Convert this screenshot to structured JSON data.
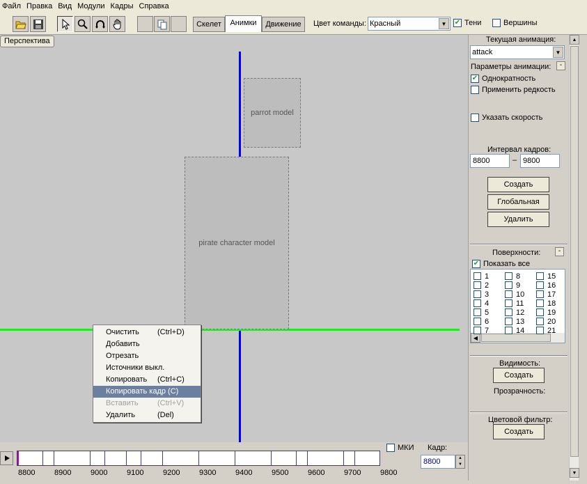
{
  "menu": [
    "Файл",
    "Правка",
    "Вид",
    "Модули",
    "Кадры",
    "Справка"
  ],
  "toolbar": {
    "icons": [
      "open-folder-icon",
      "save-icon",
      "pointer-icon",
      "zoom-icon",
      "rotate-icon",
      "hand-icon",
      "blank-icon",
      "copy-icon"
    ],
    "tabs": [
      "Скелет",
      "Анимки",
      "Движение"
    ],
    "active_tab": "Анимки",
    "team_color_label": "Цвет команды:",
    "team_color_value": "Красный",
    "shadows_label": "Тени",
    "shadows_checked": true,
    "vertices_label": "Вершины",
    "vertices_checked": false
  },
  "viewport": {
    "perspective_button": "Перспектива",
    "colors": {
      "background": "#c8c8c8",
      "axis_vertical": "#0000ff",
      "axis_horizontal": "#00ff00"
    }
  },
  "context_menu": [
    {
      "label": "Очистить",
      "shortcut": "(Ctrl+D)",
      "state": "normal"
    },
    {
      "label": "Добавить",
      "shortcut": "",
      "state": "normal"
    },
    {
      "label": "Отрезать",
      "shortcut": "",
      "state": "normal"
    },
    {
      "label": "Источники выкл.",
      "shortcut": "",
      "state": "normal"
    },
    {
      "label": "Копировать",
      "shortcut": "(Ctrl+C)",
      "state": "normal"
    },
    {
      "label": "Копировать кадр (C)",
      "shortcut": "",
      "state": "selected"
    },
    {
      "label": "Вставить",
      "shortcut": "(Ctrl+V)",
      "state": "disabled"
    },
    {
      "label": "Удалить",
      "shortcut": "(Del)",
      "state": "normal"
    }
  ],
  "timeline": {
    "ticks": [
      "8800",
      "8900",
      "9000",
      "9100",
      "9200",
      "9300",
      "9400",
      "9500",
      "9600",
      "9700",
      "9800"
    ],
    "mki_label": "МКИ",
    "mki_checked": false,
    "frame_label": "Кадр:",
    "frame_value": "8800"
  },
  "panel": {
    "current_anim_label": "Текущая анимация:",
    "current_anim_value": "attack",
    "anim_params_label": "Параметры анимации:",
    "collapse_label": "-",
    "once_label": "Однократность",
    "once_checked": true,
    "rarity_label": "Применить редкость",
    "rarity_checked": false,
    "speed_label": "Указать скорость",
    "speed_checked": false,
    "interval_label": "Интервал кадров:",
    "interval_from": "8800",
    "interval_dash": "–",
    "interval_to": "9800",
    "create_button": "Создать",
    "global_button": "Глобальная",
    "delete_button": "Удалить",
    "surfaces_label": "Поверхности:",
    "show_all_label": "Показать все",
    "show_all_checked": true,
    "surfaces": [
      "1",
      "2",
      "3",
      "4",
      "5",
      "6",
      "7",
      "8",
      "9",
      "10",
      "11",
      "12",
      "13",
      "14",
      "15",
      "16",
      "17",
      "18",
      "19",
      "20",
      "21"
    ],
    "visibility_label": "Видимость:",
    "visibility_button": "Создать",
    "transparency_label": "Прозрачность:",
    "color_filter_label": "Цветовой фильтр:",
    "color_filter_button": "Создать"
  }
}
